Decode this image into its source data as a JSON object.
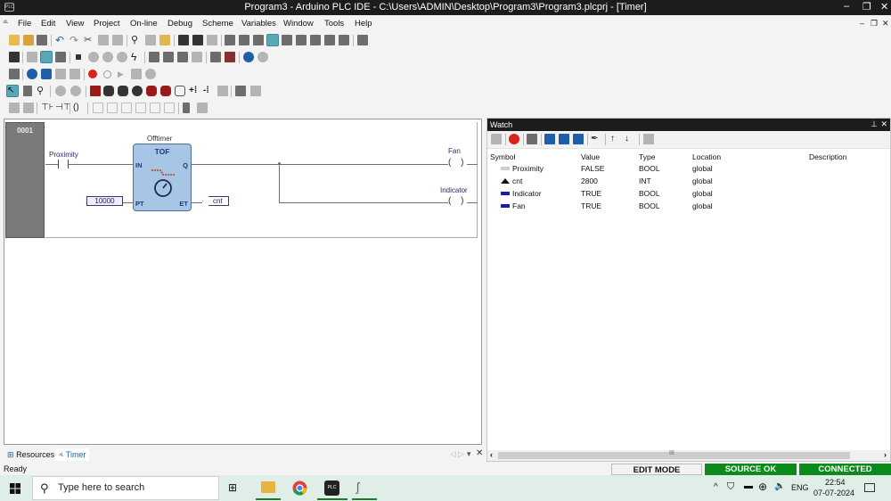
{
  "window": {
    "title": "Program3 - Arduino PLC IDE - C:\\Users\\ADMIN\\Desktop\\Program3\\Program3.plcprj - [Timer]",
    "controls": {
      "minimize": "–",
      "restore": "❐",
      "close": "✕"
    },
    "mdi_controls": {
      "minimize": "–",
      "restore": "❐",
      "close": "✕"
    }
  },
  "menu": [
    "File",
    "Edit",
    "View",
    "Project",
    "On-line",
    "Debug",
    "Scheme",
    "Variables",
    "Window",
    "Tools",
    "Help"
  ],
  "editor": {
    "rung_number": "0001",
    "contact": {
      "label": "Proximity"
    },
    "function_block": {
      "instance": "Offtimer",
      "type": "TOF",
      "inputs": [
        "IN",
        "PT"
      ],
      "outputs": [
        "Q",
        "ET"
      ]
    },
    "pt_constant": "10000",
    "et_variable": "cnt",
    "coils": [
      {
        "label": "Fan",
        "symbol": "( )"
      },
      {
        "label": "Indicator",
        "symbol": "( )"
      }
    ]
  },
  "doc_tabs": [
    {
      "label": "Resources",
      "active": false
    },
    {
      "label": "Timer",
      "active": true
    }
  ],
  "doc_tab_controls": [
    "◁",
    "▷",
    "▾",
    "✕"
  ],
  "status": {
    "text": "Ready"
  },
  "watch": {
    "title": "Watch",
    "pin": "⊥",
    "close": "✕",
    "columns": [
      "Symbol",
      "Value",
      "Type",
      "Location",
      "Description"
    ],
    "rows": [
      {
        "symbol": "Proximity",
        "value": "FALSE",
        "type": "BOOL",
        "location": "global",
        "description": "",
        "indicator": "bool-off",
        "color": "#c8d0d8"
      },
      {
        "symbol": "cnt",
        "value": "2800",
        "type": "INT",
        "location": "global",
        "description": "",
        "indicator": "analog",
        "color": "#111111"
      },
      {
        "symbol": "Indicator",
        "value": "TRUE",
        "type": "BOOL",
        "location": "global",
        "description": "",
        "indicator": "bool-on",
        "color": "#1a1ab8"
      },
      {
        "symbol": "Fan",
        "value": "TRUE",
        "type": "BOOL",
        "location": "global",
        "description": "",
        "indicator": "bool-on",
        "color": "#1a1ab8"
      }
    ],
    "scroll_thumb_label": "III"
  },
  "status_boxes": [
    {
      "label": "EDIT MODE",
      "bg": "#f3f3f3",
      "fg": "#111111"
    },
    {
      "label": "SOURCE OK",
      "bg": "#0c8a1c",
      "fg": "#ffffff"
    },
    {
      "label": "CONNECTED",
      "bg": "#0c8a1c",
      "fg": "#ffffff"
    }
  ],
  "taskbar": {
    "search_placeholder": "Type here to search",
    "tray": {
      "language": "ENG",
      "time": "22:54",
      "date": "07-07-2024"
    }
  }
}
